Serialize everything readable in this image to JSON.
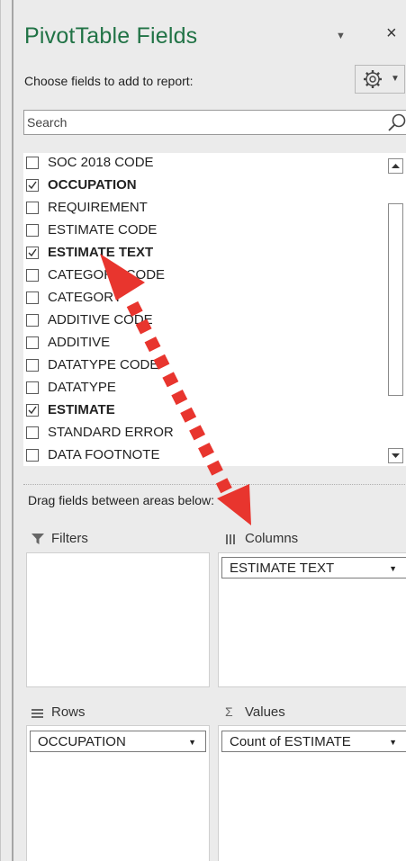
{
  "panel": {
    "title": "PivotTable Fields",
    "title_dropdown_glyph": "▼",
    "close_glyph": "×",
    "choose_label": "Choose fields to add to report:",
    "settings_icon": "gear-icon",
    "settings_dropdown_glyph": "▼"
  },
  "search": {
    "placeholder": "Search",
    "icon": "search-icon"
  },
  "fields": [
    {
      "label": "SOC 2018 CODE",
      "checked": false
    },
    {
      "label": "OCCUPATION",
      "checked": true
    },
    {
      "label": "REQUIREMENT",
      "checked": false
    },
    {
      "label": "ESTIMATE CODE",
      "checked": false
    },
    {
      "label": "ESTIMATE TEXT",
      "checked": true
    },
    {
      "label": "CATEGORY CODE",
      "checked": false
    },
    {
      "label": "CATEGORY",
      "checked": false
    },
    {
      "label": "ADDITIVE CODE",
      "checked": false
    },
    {
      "label": "ADDITIVE",
      "checked": false
    },
    {
      "label": "DATATYPE CODE",
      "checked": false
    },
    {
      "label": "DATATYPE",
      "checked": false
    },
    {
      "label": "ESTIMATE",
      "checked": true
    },
    {
      "label": "STANDARD ERROR",
      "checked": false
    },
    {
      "label": "DATA FOOTNOTE",
      "checked": false
    }
  ],
  "areas": {
    "drag_hint": "Drag fields between areas below:",
    "filters": {
      "label": "Filters",
      "icon": "filter-icon",
      "items": []
    },
    "columns": {
      "label": "Columns",
      "icon": "columns-icon",
      "items": [
        "ESTIMATE TEXT"
      ]
    },
    "rows": {
      "label": "Rows",
      "icon": "rows-icon",
      "items": [
        "OCCUPATION"
      ]
    },
    "values": {
      "label": "Values",
      "icon": "sigma-icon",
      "items": [
        "Count of ESTIMATE"
      ]
    }
  },
  "annotation": {
    "arrow_color": "#e8352e",
    "style": "dotted double-headed arrow"
  }
}
